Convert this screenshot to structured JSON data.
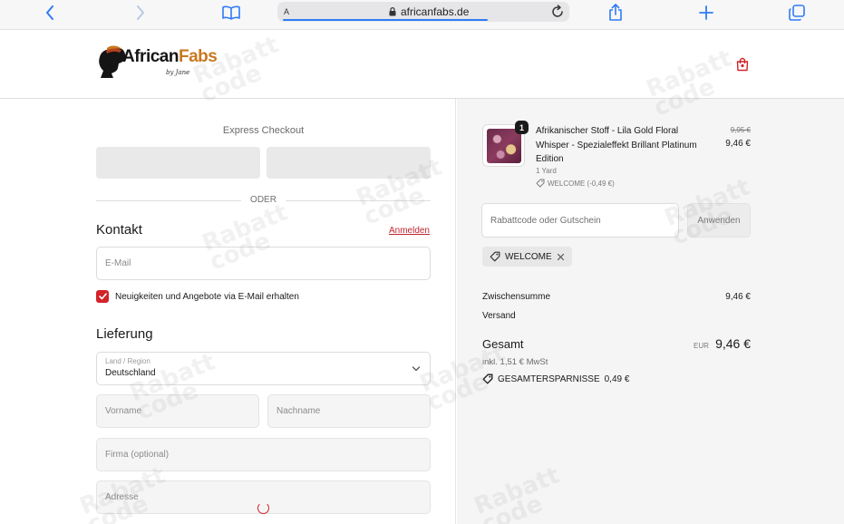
{
  "browser": {
    "text_size_label": "A",
    "url": "africanfabs.de"
  },
  "header": {
    "brand_part1": "African",
    "brand_part2": "Fabs",
    "brand_tagline": "by Jane"
  },
  "checkout": {
    "express_title": "Express Checkout",
    "divider_text": "ODER",
    "contact_heading": "Kontakt",
    "login_link": "Anmelden",
    "email_placeholder": "E-Mail",
    "newsletter_label": "Neuigkeiten und Angebote via E-Mail erhalten",
    "delivery_heading": "Lieferung",
    "country_label": "Land / Region",
    "country_value": "Deutschland",
    "firstname_placeholder": "Vorname",
    "lastname_placeholder": "Nachname",
    "company_placeholder": "Firma (optional)",
    "address_placeholder": "Adresse"
  },
  "summary": {
    "item": {
      "quantity": "1",
      "title": "Afrikanischer Stoff - Lila Gold Floral Whisper - Spezialeffekt Brillant Platinum Edition",
      "variant": "1 Yard",
      "discount_line": "WELCOME (-0,49 €)",
      "price_old": "9,95 €",
      "price_new": "9,46 €"
    },
    "discount_placeholder": "Rabattcode oder Gutschein",
    "apply_label": "Anwenden",
    "applied_code": "WELCOME",
    "subtotal_label": "Zwischensumme",
    "subtotal_value": "9,46 €",
    "shipping_label": "Versand",
    "total_label": "Gesamt",
    "total_currency": "EUR",
    "total_value": "9,46 €",
    "tax_line": "inkl. 1,51 € MwSt",
    "savings_label": "GESAMTERSPARNISSE",
    "savings_value": "0,49 €"
  },
  "watermark": {
    "line1": "Rabatt",
    "line2": "code"
  },
  "colors": {
    "accent": "#d12329",
    "browser_blue": "#2f7bf6",
    "brand_orange": "#c9781f"
  }
}
